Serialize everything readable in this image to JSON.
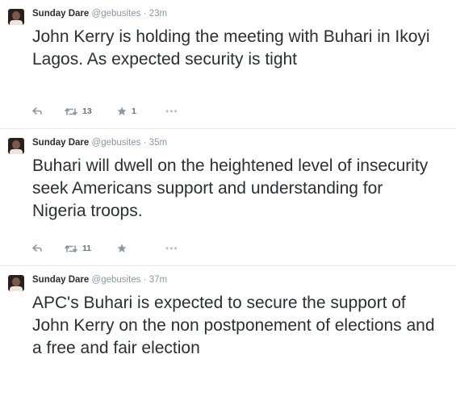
{
  "tweets": [
    {
      "name": "Sunday Dare",
      "handle": "@gebusites",
      "dot": "·",
      "time": "23m",
      "text": "John Kerry is holding the meeting with Buhari in Ikoyi Lagos. As expected security is tight",
      "retweets": "13",
      "favorites": "1",
      "more": "•••"
    },
    {
      "name": "Sunday Dare",
      "handle": "@gebusites",
      "dot": "·",
      "time": "35m",
      "text": "Buhari will dwell on the heightened level of insecurity seek Americans support and understanding for Nigeria troops.",
      "retweets": "11",
      "favorites": "",
      "more": "•••"
    },
    {
      "name": "Sunday Dare",
      "handle": "@gebusites",
      "dot": "·",
      "time": "37m",
      "text": "APC's Buhari is expected to secure the support of John Kerry on the non postponement of elections and a free and fair election"
    }
  ],
  "icons": {
    "reply": "reply-arrow-icon",
    "retweet": "retweet-arrows-icon",
    "favorite": "star-icon",
    "more": "more-dots-icon"
  },
  "colors": {
    "text": "#292f33",
    "muted": "#8899a6",
    "divider": "#e1e8ed"
  }
}
